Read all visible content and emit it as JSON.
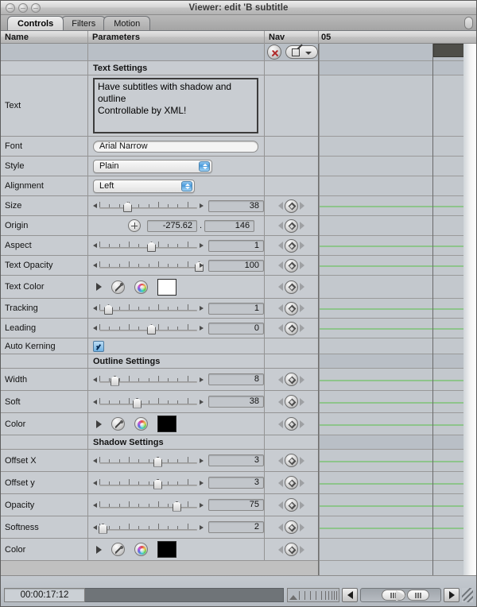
{
  "window": {
    "title": "Viewer: edit 'B subtitle",
    "traffic_lights": [
      "close",
      "minimize",
      "zoom"
    ]
  },
  "tabs": [
    {
      "label": "Controls",
      "active": true
    },
    {
      "label": "Filters",
      "active": false
    },
    {
      "label": "Motion",
      "active": false
    }
  ],
  "columns": {
    "name": "Name",
    "parameters": "Parameters",
    "nav": "Nav",
    "ruler_label": "05"
  },
  "toolbar": {
    "reset_label": "reset-x",
    "edit_label": "edit-menu"
  },
  "sections": {
    "text": "Text Settings",
    "outline": "Outline Settings",
    "shadow": "Shadow Settings"
  },
  "rows": [
    {
      "name": "Text",
      "type": "textarea",
      "value": "Have subtitles with shadow and outline\nControllable by XML!",
      "nav": false
    },
    {
      "name": "Font",
      "type": "textfield",
      "value": "Arial Narrow",
      "nav": false
    },
    {
      "name": "Style",
      "type": "popup",
      "value": "Plain",
      "width": "style",
      "nav": false
    },
    {
      "name": "Alignment",
      "type": "popup",
      "value": "Left",
      "width": "align",
      "nav": false
    },
    {
      "name": "Size",
      "type": "slider",
      "value": "38",
      "pos": 30,
      "nav": true
    },
    {
      "name": "Origin",
      "type": "point",
      "x": "-275.62",
      "y": "146",
      "nav": true
    },
    {
      "name": "Aspect",
      "type": "slider",
      "value": "1",
      "pos": 50,
      "nav": true
    },
    {
      "name": "Text Opacity",
      "type": "slider",
      "value": "100",
      "pos": 100,
      "nav": true
    },
    {
      "name": "Text Color",
      "type": "color",
      "swatch": "#ffffff",
      "nav": true
    },
    {
      "name": "Tracking",
      "type": "slider",
      "value": "1",
      "pos": 9,
      "nav": true
    },
    {
      "name": "Leading",
      "type": "slider",
      "value": "0",
      "pos": 50,
      "nav": true
    },
    {
      "name": "Auto Kerning",
      "type": "checkbox",
      "checked": true,
      "nav": false
    },
    {
      "name": "Width",
      "type": "slider",
      "value": "8",
      "pos": 17,
      "nav": true
    },
    {
      "name": "Soft",
      "type": "slider",
      "value": "38",
      "pos": 38,
      "nav": true
    },
    {
      "name": "Color",
      "type": "color",
      "swatch": "#000000",
      "nav": true
    },
    {
      "name": "Offset X",
      "type": "slider",
      "value": "3",
      "pos": 55,
      "nav": true
    },
    {
      "name": "Offset y",
      "type": "slider",
      "value": "3",
      "pos": 55,
      "nav": true
    },
    {
      "name": "Opacity",
      "type": "slider",
      "value": "75",
      "pos": 73,
      "nav": true
    },
    {
      "name": "Softness",
      "type": "slider",
      "value": "2",
      "pos": 4,
      "nav": true
    },
    {
      "name": "Color",
      "type": "color",
      "swatch": "#000000",
      "nav": true
    }
  ],
  "statusbar": {
    "timecode": "00:00:17:12",
    "prev_label": "scroll-left",
    "next_label": "scroll-right"
  },
  "colors": {
    "keyframe_track": "#8ec48b",
    "playhead": "#f2d81e",
    "panel_bg": "#c8ccd1",
    "accent_blue": "#3f93d8"
  }
}
